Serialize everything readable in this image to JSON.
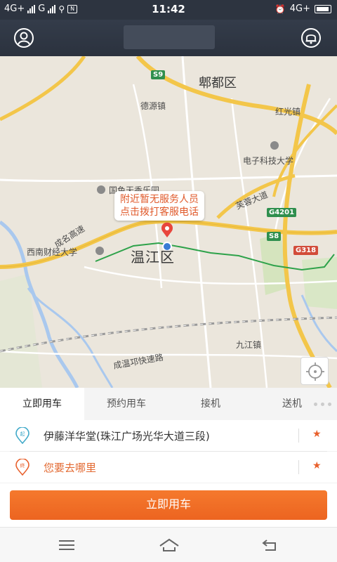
{
  "status_bar": {
    "network_left": "4G+",
    "carrier_g": "G",
    "time": "11:42",
    "network_right": "4G+"
  },
  "header": {
    "profile_icon": "user-circle-icon",
    "bell_icon": "bell-icon"
  },
  "map": {
    "labels": {
      "pixian": "郫都区",
      "deyuan": "德源镇",
      "hongguang": "红光镇",
      "uestc": "电子科技大学",
      "guoyuan": "国色天香乐园",
      "furong": "芙蓉大道",
      "chengguan": "成名高速",
      "swufe": "西南财经大学",
      "wenjiang": "温江区",
      "jiujiang": "九江镇",
      "chengwen": "成温邛快速路"
    },
    "shields": {
      "s9": "S9",
      "g4201": "G4201",
      "s8": "S8",
      "g318": "G318"
    },
    "popup_line1": "附近暂无服务人员",
    "popup_line2": "点击拨打客服电话",
    "locate_icon": "locate-crosshair-icon"
  },
  "tabs": [
    {
      "label": "立即用车",
      "active": true
    },
    {
      "label": "预约用车",
      "active": false
    },
    {
      "label": "接机",
      "active": false
    },
    {
      "label": "送机",
      "active": false
    }
  ],
  "origin": {
    "text": "伊藤洋华堂(珠江广场光华大道三段)",
    "icon": "origin-pin-icon",
    "star": "★"
  },
  "destination": {
    "placeholder": "您要去哪里",
    "icon": "destination-pin-icon",
    "star": "★"
  },
  "cta_label": "立即用车",
  "colors": {
    "accent": "#ec6420",
    "header": "#2f3642",
    "road_yellow": "#f3c64a",
    "route_green": "#2ea24a"
  }
}
